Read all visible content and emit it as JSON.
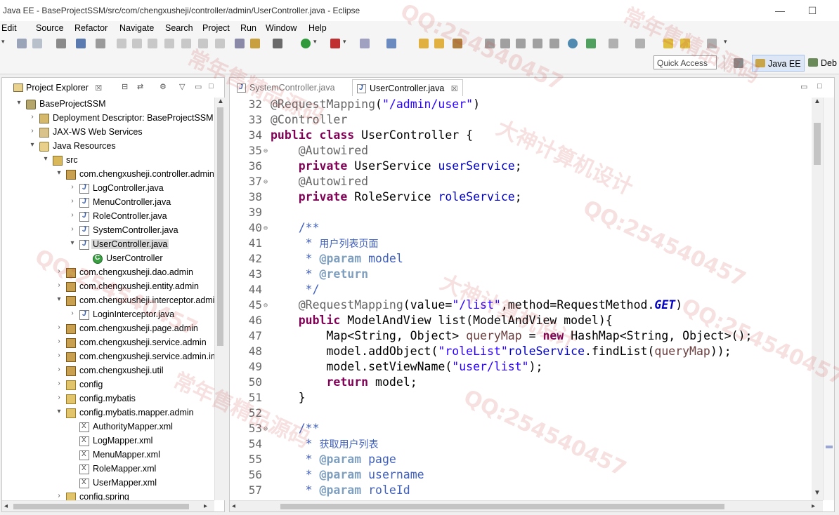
{
  "window": {
    "title": "Java EE - BaseProjectSSM/src/com/chengxusheji/controller/admin/UserController.java - Eclipse",
    "minimize_glyph": "—",
    "maximize_glyph": "☐"
  },
  "menu": [
    "Edit",
    "Source",
    "Refactor",
    "Navigate",
    "Search",
    "Project",
    "Run",
    "Window",
    "Help"
  ],
  "quick_access": {
    "placeholder": "Quick Access"
  },
  "perspectives": [
    {
      "label": "Java EE",
      "active": true
    },
    {
      "label": "Deb",
      "active": false
    }
  ],
  "explorer": {
    "tab_label": "Project Explorer",
    "close_glyph": "☒",
    "tree": [
      {
        "label": "BaseProjectSSM",
        "depth": 0,
        "twisty": "▾",
        "icon": "project"
      },
      {
        "label": "Deployment Descriptor: BaseProjectSSM",
        "depth": 1,
        "twisty": "›",
        "icon": "descriptor"
      },
      {
        "label": "JAX-WS Web Services",
        "depth": 1,
        "twisty": "›",
        "icon": "jaxws"
      },
      {
        "label": "Java Resources",
        "depth": 1,
        "twisty": "▾",
        "icon": "javares"
      },
      {
        "label": "src",
        "depth": 2,
        "twisty": "▾",
        "icon": "srcfolder"
      },
      {
        "label": "com.chengxusheji.controller.admin",
        "depth": 3,
        "twisty": "▾",
        "icon": "pkg"
      },
      {
        "label": "LogController.java",
        "depth": 4,
        "twisty": "›",
        "icon": "java"
      },
      {
        "label": "MenuController.java",
        "depth": 4,
        "twisty": "›",
        "icon": "java"
      },
      {
        "label": "RoleController.java",
        "depth": 4,
        "twisty": "›",
        "icon": "java"
      },
      {
        "label": "SystemController.java",
        "depth": 4,
        "twisty": "›",
        "icon": "java"
      },
      {
        "label": "UserController.java",
        "depth": 4,
        "twisty": "▾",
        "icon": "java",
        "selected": true
      },
      {
        "label": "UserController",
        "depth": 5,
        "twisty": "",
        "icon": "cls"
      },
      {
        "label": "com.chengxusheji.dao.admin",
        "depth": 3,
        "twisty": "›",
        "icon": "pkg"
      },
      {
        "label": "com.chengxusheji.entity.admin",
        "depth": 3,
        "twisty": "›",
        "icon": "pkg"
      },
      {
        "label": "com.chengxusheji.interceptor.admin",
        "depth": 3,
        "twisty": "▾",
        "icon": "pkg"
      },
      {
        "label": "LoginInterceptor.java",
        "depth": 4,
        "twisty": "›",
        "icon": "java"
      },
      {
        "label": "com.chengxusheji.page.admin",
        "depth": 3,
        "twisty": "›",
        "icon": "pkg"
      },
      {
        "label": "com.chengxusheji.service.admin",
        "depth": 3,
        "twisty": "›",
        "icon": "pkg"
      },
      {
        "label": "com.chengxusheji.service.admin.impl",
        "depth": 3,
        "twisty": "›",
        "icon": "pkg"
      },
      {
        "label": "com.chengxusheji.util",
        "depth": 3,
        "twisty": "›",
        "icon": "pkg"
      },
      {
        "label": "config",
        "depth": 3,
        "twisty": "›",
        "icon": "folder"
      },
      {
        "label": "config.mybatis",
        "depth": 3,
        "twisty": "›",
        "icon": "folder"
      },
      {
        "label": "config.mybatis.mapper.admin",
        "depth": 3,
        "twisty": "▾",
        "icon": "folder"
      },
      {
        "label": "AuthorityMapper.xml",
        "depth": 4,
        "twisty": "",
        "icon": "xml"
      },
      {
        "label": "LogMapper.xml",
        "depth": 4,
        "twisty": "",
        "icon": "xml"
      },
      {
        "label": "MenuMapper.xml",
        "depth": 4,
        "twisty": "",
        "icon": "xml"
      },
      {
        "label": "RoleMapper.xml",
        "depth": 4,
        "twisty": "",
        "icon": "xml"
      },
      {
        "label": "UserMapper.xml",
        "depth": 4,
        "twisty": "",
        "icon": "xml"
      },
      {
        "label": "config.spring",
        "depth": 3,
        "twisty": "›",
        "icon": "folder"
      }
    ]
  },
  "editor": {
    "tabs": [
      {
        "label": "SystemController.java",
        "active": false
      },
      {
        "label": "UserController.java",
        "active": true,
        "close": "☒"
      }
    ],
    "lines": [
      {
        "n": "32",
        "fold": "",
        "segs": [
          [
            "ann",
            "@RequestMapping"
          ],
          [
            "",
            "("
          ],
          [
            "str",
            "\"/admin/user\""
          ],
          [
            "",
            ")"
          ]
        ]
      },
      {
        "n": "33",
        "fold": "",
        "segs": [
          [
            "ann",
            "@Controller"
          ]
        ]
      },
      {
        "n": "34",
        "fold": "",
        "segs": [
          [
            "kw",
            "public class"
          ],
          [
            "",
            " UserController {"
          ]
        ]
      },
      {
        "n": "35",
        "fold": "⊖",
        "segs": [
          [
            "",
            "    "
          ],
          [
            "ann",
            "@Autowired"
          ]
        ]
      },
      {
        "n": "36",
        "fold": "",
        "segs": [
          [
            "",
            "    "
          ],
          [
            "kw",
            "private"
          ],
          [
            "",
            " UserService "
          ],
          [
            "fld",
            "userService"
          ],
          [
            "",
            ";"
          ]
        ]
      },
      {
        "n": "37",
        "fold": "⊖",
        "segs": [
          [
            "",
            "    "
          ],
          [
            "ann",
            "@Autowired"
          ]
        ]
      },
      {
        "n": "38",
        "fold": "",
        "segs": [
          [
            "",
            "    "
          ],
          [
            "kw",
            "private"
          ],
          [
            "",
            " RoleService "
          ],
          [
            "fld",
            "roleService"
          ],
          [
            "",
            ";"
          ]
        ]
      },
      {
        "n": "39",
        "fold": "",
        "segs": []
      },
      {
        "n": "40",
        "fold": "⊖",
        "segs": [
          [
            "",
            "    "
          ],
          [
            "doc",
            "/**"
          ]
        ]
      },
      {
        "n": "41",
        "fold": "",
        "segs": [
          [
            "",
            "     "
          ],
          [
            "doc",
            "* "
          ],
          [
            "cn",
            "用户列表页面"
          ]
        ]
      },
      {
        "n": "42",
        "fold": "",
        "segs": [
          [
            "",
            "     "
          ],
          [
            "doc",
            "* "
          ],
          [
            "tag",
            "@param"
          ],
          [
            "doc",
            " model"
          ]
        ]
      },
      {
        "n": "43",
        "fold": "",
        "segs": [
          [
            "",
            "     "
          ],
          [
            "doc",
            "* "
          ],
          [
            "tag",
            "@return"
          ]
        ]
      },
      {
        "n": "44",
        "fold": "",
        "segs": [
          [
            "",
            "     "
          ],
          [
            "doc",
            "*/"
          ]
        ]
      },
      {
        "n": "45",
        "fold": "⊖",
        "segs": [
          [
            "",
            "    "
          ],
          [
            "ann",
            "@RequestMapping"
          ],
          [
            "",
            "(value="
          ],
          [
            "str",
            "\"/list\""
          ],
          [
            "",
            ",method=RequestMethod."
          ],
          [
            "ital",
            "GET"
          ],
          [
            "",
            ")"
          ]
        ]
      },
      {
        "n": "46",
        "fold": "",
        "segs": [
          [
            "",
            "    "
          ],
          [
            "kw",
            "public"
          ],
          [
            "",
            " ModelAndView list(ModelAndView model){"
          ]
        ]
      },
      {
        "n": "47",
        "fold": "",
        "segs": [
          [
            "",
            "        Map<String, Object> "
          ],
          [
            "var",
            "queryMap"
          ],
          [
            "",
            " = "
          ],
          [
            "kw",
            "new"
          ],
          [
            "",
            " HashMap<String, Object>();"
          ]
        ]
      },
      {
        "n": "48",
        "fold": "",
        "segs": [
          [
            "",
            "        model.addObject("
          ],
          [
            "str",
            "\"roleList\""
          ],
          [
            ", ",
            ""
          ],
          [
            "fld",
            "roleService"
          ],
          [
            "",
            ".findList("
          ],
          [
            "var",
            "queryMap"
          ],
          [
            "",
            "));"
          ]
        ]
      },
      {
        "n": "49",
        "fold": "",
        "segs": [
          [
            "",
            "        model.setViewName("
          ],
          [
            "str",
            "\"user/list\""
          ],
          [
            "",
            ");"
          ]
        ]
      },
      {
        "n": "50",
        "fold": "",
        "segs": [
          [
            "",
            "        "
          ],
          [
            "kw",
            "return"
          ],
          [
            "",
            " model;"
          ]
        ]
      },
      {
        "n": "51",
        "fold": "",
        "segs": [
          [
            "",
            "    }"
          ]
        ]
      },
      {
        "n": "52",
        "fold": "",
        "segs": []
      },
      {
        "n": "53",
        "fold": "⊖",
        "segs": [
          [
            "",
            "    "
          ],
          [
            "doc",
            "/**"
          ]
        ]
      },
      {
        "n": "54",
        "fold": "",
        "segs": [
          [
            "",
            "     "
          ],
          [
            "doc",
            "* "
          ],
          [
            "cn",
            "获取用户列表"
          ]
        ]
      },
      {
        "n": "55",
        "fold": "",
        "segs": [
          [
            "",
            "     "
          ],
          [
            "doc",
            "* "
          ],
          [
            "tag",
            "@param"
          ],
          [
            "doc",
            " page"
          ]
        ]
      },
      {
        "n": "56",
        "fold": "",
        "segs": [
          [
            "",
            "     "
          ],
          [
            "doc",
            "* "
          ],
          [
            "tag",
            "@param"
          ],
          [
            "doc",
            " username"
          ]
        ]
      },
      {
        "n": "57",
        "fold": "",
        "segs": [
          [
            "",
            "     "
          ],
          [
            "doc",
            "* "
          ],
          [
            "tag",
            "@param"
          ],
          [
            "doc",
            " roleId"
          ]
        ]
      }
    ]
  },
  "watermarks": [
    "QQ:254540457",
    "常年售精品源码",
    "大神计算机设计",
    "QQ:254540457",
    "常年售精品源码",
    "QQ:254540457",
    "大神计算机设计",
    "QQ:254540457",
    "常年售精品源码",
    "QQ:254540457"
  ]
}
